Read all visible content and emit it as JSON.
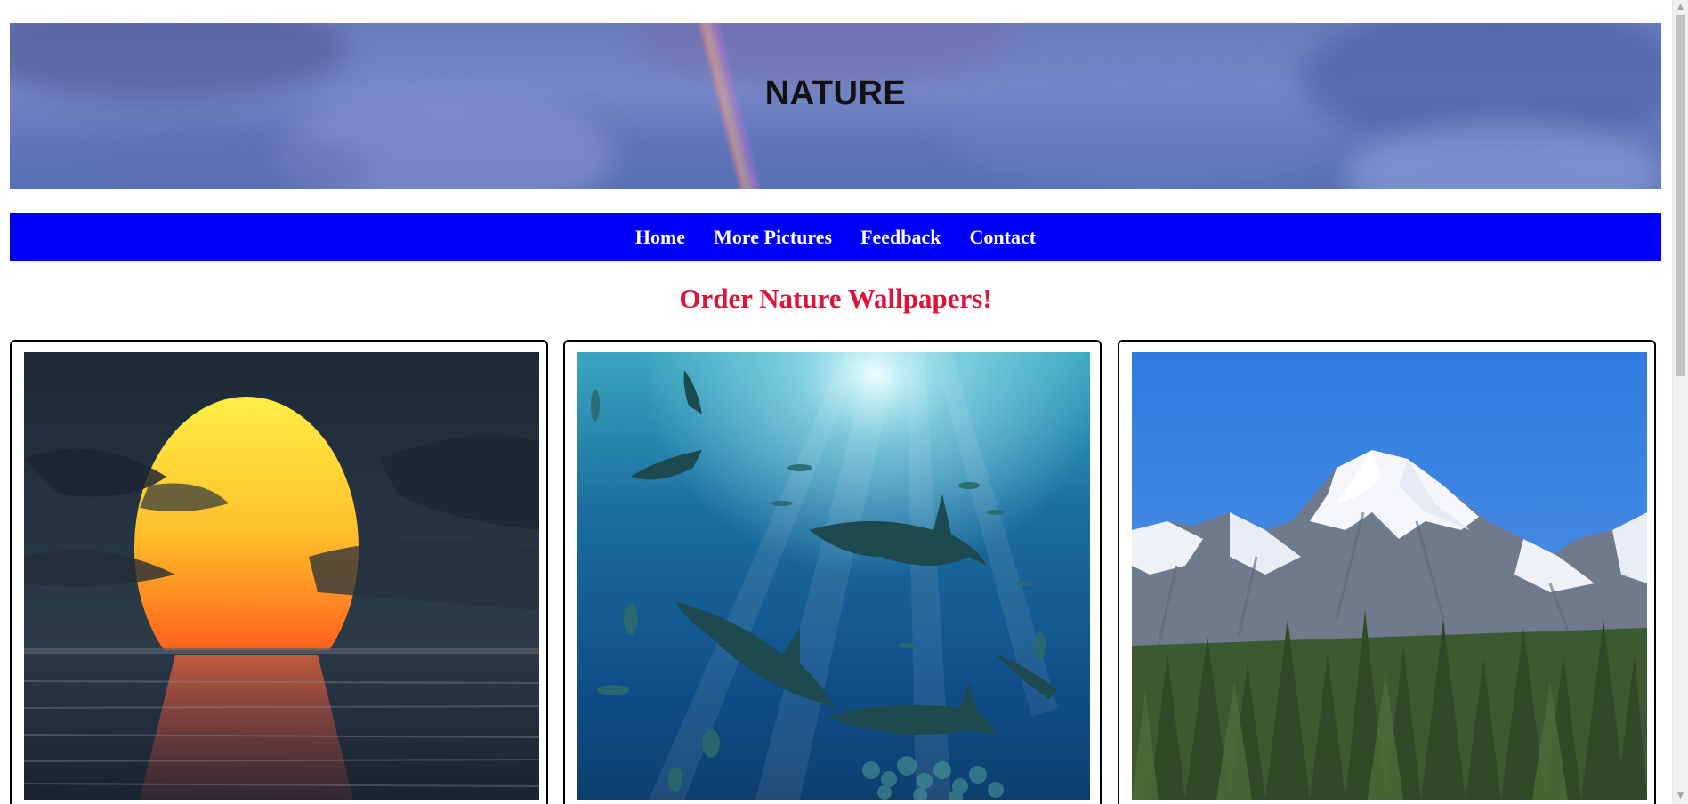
{
  "banner": {
    "title": "NATURE"
  },
  "nav": {
    "items": [
      {
        "label": "Home"
      },
      {
        "label": "More Pictures"
      },
      {
        "label": "Feedback"
      },
      {
        "label": "Contact"
      }
    ]
  },
  "main": {
    "heading": "Order Nature Wallpapers!"
  },
  "cards": [
    {
      "image": "sunset-over-ocean"
    },
    {
      "image": "sharks-underwater"
    },
    {
      "image": "snowy-mountain-forest"
    }
  ],
  "colors": {
    "nav_background": "#0000ff",
    "heading": "#dc143c",
    "nav_text": "#ffffff"
  }
}
